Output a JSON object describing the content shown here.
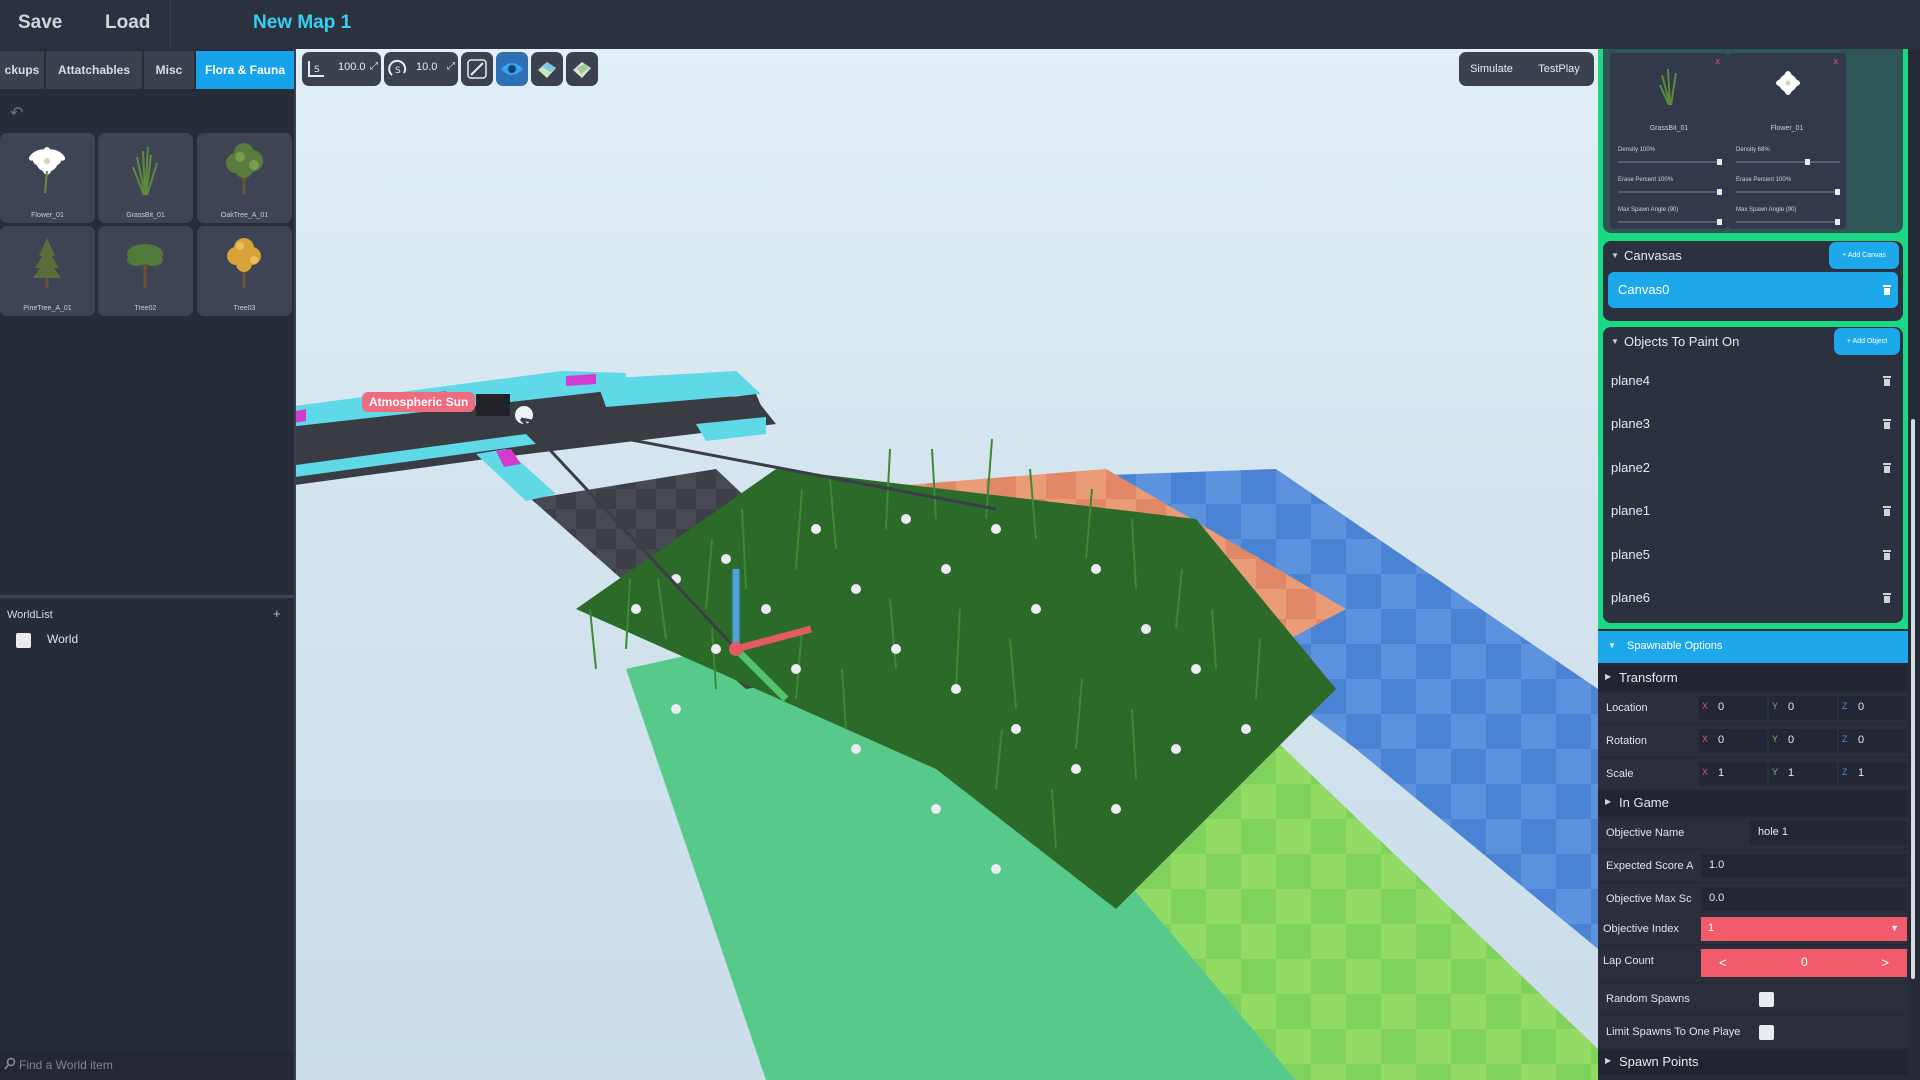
{
  "topbar": {
    "save": "Save",
    "load": "Load",
    "map_title": "New Map 1"
  },
  "left": {
    "tabs": [
      {
        "label": "ckups",
        "active": false
      },
      {
        "label": "Attatchables",
        "active": false
      },
      {
        "label": "Misc",
        "active": false
      },
      {
        "label": "Flora & Fauna",
        "active": true
      }
    ],
    "assets": [
      {
        "label": "Flower_01",
        "icon": "flower-icon"
      },
      {
        "label": "GrassBit_01",
        "icon": "grass-icon"
      },
      {
        "label": "OakTree_A_01",
        "icon": "oak-tree-icon"
      },
      {
        "label": "PineTree_A_01",
        "icon": "pine-tree-icon"
      },
      {
        "label": "Tree02",
        "icon": "tree-icon"
      },
      {
        "label": "Tree03",
        "icon": "autumn-tree-icon"
      }
    ],
    "worldlist": {
      "title": "WorldList",
      "add": "+",
      "items": [
        "World"
      ]
    },
    "search": {
      "placeholder": "Find a World item"
    }
  },
  "viewport": {
    "toolbar": {
      "move_snap": "100.0",
      "rotate_snap": "10.0"
    },
    "simulate": "Simulate",
    "testplay": "TestPlay",
    "sun_label": "Atmospheric Sun"
  },
  "right": {
    "brushes": [
      {
        "name": "GrassBit_01",
        "density_label": "Density 100%",
        "density": 1.0,
        "erase_label": "Erase Percent 100%",
        "erase": 1.0,
        "angle_label": "Max Spawn Angle (90)",
        "angle": 1.0,
        "remove": "x"
      },
      {
        "name": "Flower_01",
        "density_label": "Density 68%",
        "density": 0.68,
        "erase_label": "Erase Percent 100%",
        "erase": 1.0,
        "angle_label": "Max Spawn Angle (90)",
        "angle": 1.0,
        "remove": "x"
      }
    ],
    "canvasas": {
      "title": "Canvasas",
      "add": "+ Add Canvas",
      "items": [
        "Canvas0"
      ]
    },
    "objects": {
      "title": "Objects To Paint On",
      "add": "+ Add Object",
      "items": [
        "plane4",
        "plane3",
        "plane2",
        "plane1",
        "plane5",
        "plane6"
      ]
    },
    "spawnable": {
      "title": "Spawnable Options",
      "transform": {
        "title": "Transform",
        "rows": [
          {
            "label": "Location",
            "x": "0",
            "y": "0",
            "z": "0"
          },
          {
            "label": "Rotation",
            "x": "0",
            "y": "0",
            "z": "0"
          },
          {
            "label": "Scale",
            "x": "1",
            "y": "1",
            "z": "1"
          }
        ]
      },
      "ingame": {
        "title": "In Game",
        "objective_name_label": "Objective Name",
        "objective_name": "hole 1",
        "expected_score_label": "Expected Score A",
        "expected_score": "1.0",
        "objective_max_label": "Objective Max Sc",
        "objective_max": "0.0",
        "objective_index_label": "Objective Index",
        "objective_index": "1",
        "lap_count_label": "Lap Count",
        "lap_count": "0",
        "lap_prev": "<",
        "lap_next": ">",
        "random_spawns_label": "Random Spawns",
        "limit_spawns_label": "Limit Spawns To One Playe"
      },
      "spawn_points": "Spawn Points"
    }
  },
  "colors": {
    "accent": "#1ea8ec",
    "green": "#1bd883",
    "red": "#f15b6c",
    "title": "#35d0f0"
  }
}
